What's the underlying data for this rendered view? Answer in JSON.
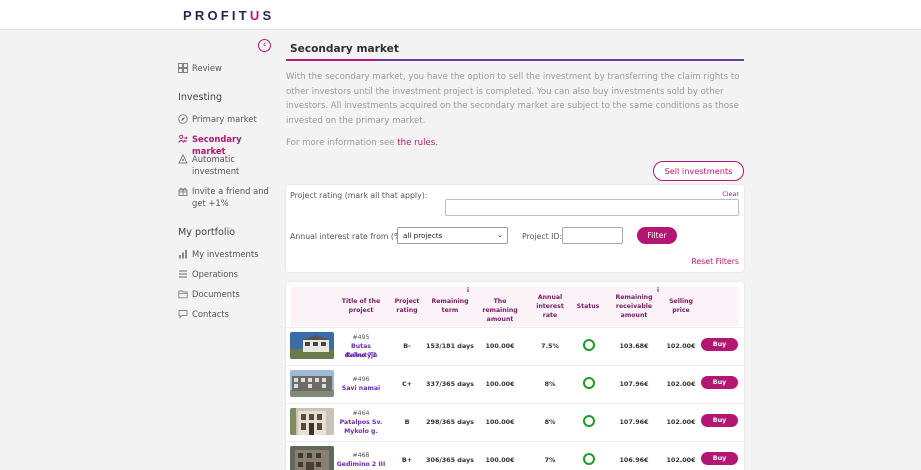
{
  "header": {
    "logo_pre": "PROFIT",
    "logo_u": "U",
    "logo_post": "S"
  },
  "sidebar": {
    "review": "Review",
    "investing_title": "Investing",
    "primary": "Primary market",
    "secondary": "Secondary market",
    "auto": "Automatic investment",
    "invite": "Invite a friend and get +1%",
    "portfolio_title": "My portfolio",
    "my_investments": "My investments",
    "operations": "Operations",
    "documents": "Documents",
    "contacts": "Contacts"
  },
  "main": {
    "title": "Secondary market",
    "description": "With the secondary market, you have the option to sell the investment by transferring the claim rights to other investors until the investment project is completed. You can also buy investments sold by other investors. All investments acquired on the secondary market are subject to the same conditions as those invested on the primary market.",
    "more_info_prefix": "For more information see ",
    "more_info_link": "the rules.",
    "sell_button": "Sell investments"
  },
  "filters": {
    "rating_label": "Project rating (mark all that apply):",
    "clear": "Clear",
    "interest_label": "Annual interest rate from (%)",
    "interest_value": "all projects",
    "project_id_label": "Project ID:",
    "filter_button": "Filter",
    "reset": "Reset Filters"
  },
  "table": {
    "headers": {
      "title_l1": "Title of the",
      "title_l2": "project",
      "rating_l1": "Project",
      "rating_l2": "rating",
      "term_l1": "Remaining",
      "term_l2": "term",
      "amount_l1": "The remaining",
      "amount_l2": "amount",
      "interest_l1": "Annual",
      "interest_l2": "interest",
      "interest_l3": "rate",
      "status": "Status",
      "receivable_l1": "Remaining",
      "receivable_l2": "receivable",
      "receivable_l3": "amount",
      "price_l1": "Selling",
      "price_l2": "price",
      "info": "i"
    },
    "rows": [
      {
        "id": "#495",
        "name_l1": "Butas dvibutyje",
        "name_l2": "Kalno 77",
        "rating": "B-",
        "term": "153/181 days",
        "amount": "100.00€",
        "rate": "7.5%",
        "receivable": "103.68€",
        "price": "102.00€",
        "buy": "Buy"
      },
      {
        "id": "#496",
        "name_l1": "Savi namai",
        "name_l2": "",
        "rating": "C+",
        "term": "337/365 days",
        "amount": "100.00€",
        "rate": "8%",
        "receivable": "107.96€",
        "price": "102.00€",
        "buy": "Buy"
      },
      {
        "id": "#464",
        "name_l1": "Patalpos Sv.",
        "name_l2": "Mykolo g.",
        "rating": "B",
        "term": "298/365 days",
        "amount": "100.00€",
        "rate": "8%",
        "receivable": "107.96€",
        "price": "102.00€",
        "buy": "Buy"
      },
      {
        "id": "#468",
        "name_l1": "Gedimino 2 III",
        "name_l2": "",
        "rating": "B+",
        "term": "306/365 days",
        "amount": "100.00€",
        "rate": "7%",
        "receivable": "106.96€",
        "price": "102.00€",
        "buy": "Buy"
      }
    ]
  },
  "colors": {
    "accent": "#b31774",
    "navy": "#2b2350",
    "status_ok": "#1e9b2a"
  }
}
